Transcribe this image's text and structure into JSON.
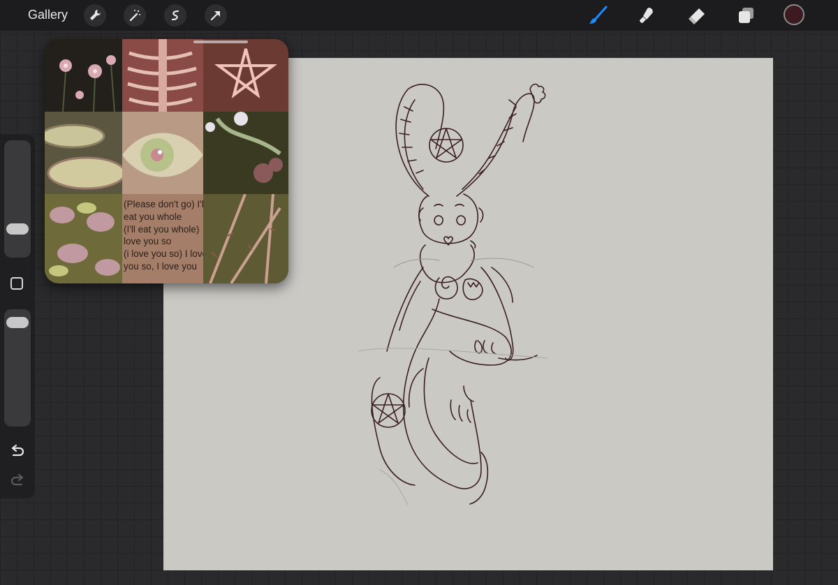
{
  "toolbar": {
    "gallery_label": "Gallery",
    "left_tools": [
      "wrench-icon",
      "magic-wand-icon",
      "selection-icon",
      "transform-arrow-icon"
    ],
    "right_tools": [
      "brush-icon",
      "smudge-icon",
      "eraser-icon",
      "layers-icon"
    ],
    "active_tool": "brush",
    "accent_color": "#1a8cff",
    "current_color": "#3b1a20"
  },
  "sidebar": {
    "brush_size_level": 0.8,
    "opacity_level": 0.05,
    "controls": [
      "brush-size-slider",
      "modify-button",
      "opacity-slider",
      "undo-button",
      "redo-button"
    ]
  },
  "reference": {
    "lyrics_lines": [
      "(Please don't go) I'll",
      "eat you whole",
      "(I'll eat you whole)",
      "love you so",
      "(i love you so) I love",
      "you so, I love you"
    ]
  },
  "canvas": {
    "background_color": "#cac9c4",
    "sketch_color": "#3a1f22"
  }
}
